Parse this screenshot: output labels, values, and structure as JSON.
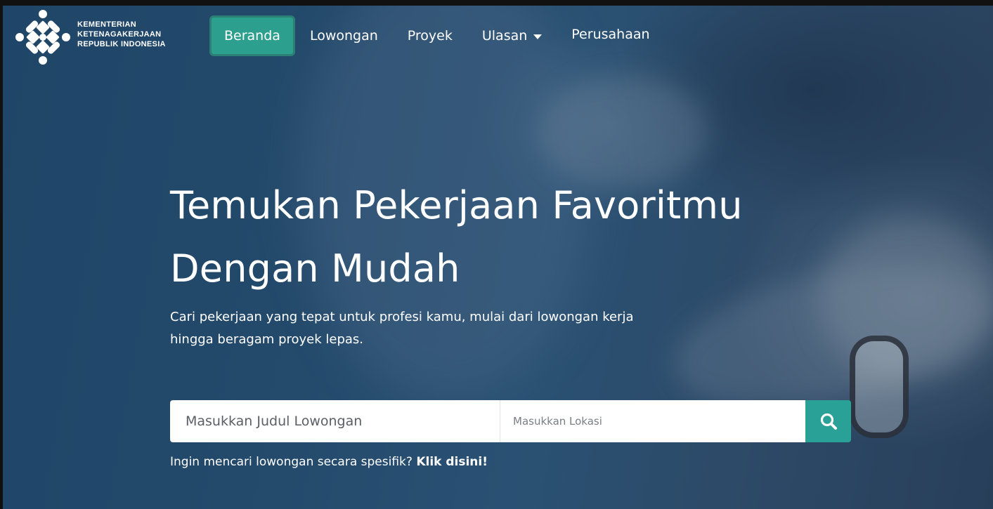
{
  "brand": {
    "logo_icon": "kemnaker-logo",
    "lines": [
      "KEMENTERIAN",
      "KETENAGAKERJAAN",
      "REPUBLIK INDONESIA"
    ]
  },
  "nav": {
    "items": [
      {
        "label": "Beranda",
        "active": true
      },
      {
        "label": "Lowongan"
      },
      {
        "label": "Proyek"
      },
      {
        "label": "Ulasan",
        "dropdown": true
      },
      {
        "label": "Perusahaan"
      }
    ]
  },
  "hero": {
    "title_line1": "Temukan Pekerjaan Favoritmu",
    "title_line2": "Dengan Mudah",
    "subtitle": "Cari pekerjaan yang tepat untuk profesi kamu, mulai dari lowongan kerja hingga beragam proyek lepas."
  },
  "search": {
    "title_placeholder": "Masukkan Judul Lowongan",
    "location_placeholder": "Masukkan Lokasi",
    "button_icon": "search-icon"
  },
  "hint": {
    "text": "Ingin mencari lowongan secara spesifik?",
    "link": "Klik disini!"
  },
  "colors": {
    "accent": "#2aa196",
    "active_nav": "#2d9f8e",
    "hero_overlay": "#23496b"
  }
}
